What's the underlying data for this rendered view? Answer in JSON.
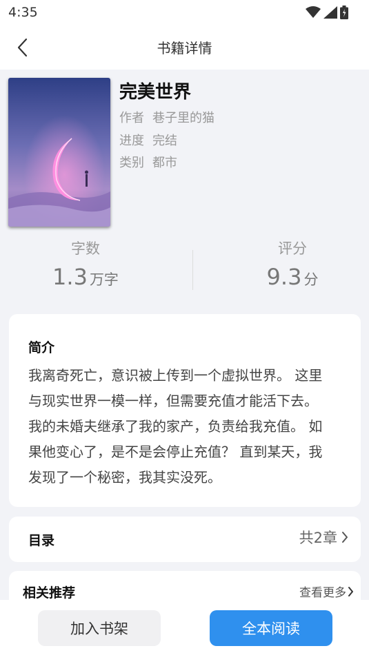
{
  "status_bar": {
    "time": "4:35",
    "icons": [
      "wifi-icon",
      "signal-icon",
      "battery-icon"
    ]
  },
  "nav": {
    "back_icon": "chevron-left-icon",
    "title": "书籍详情"
  },
  "book": {
    "title": "完美世界",
    "author_label": "作者",
    "author": "巷子里的猫",
    "progress_label": "进度",
    "progress": "完结",
    "category_label": "类别",
    "category": "都市"
  },
  "stats": {
    "words_label": "字数",
    "words_value": "1.3",
    "words_unit": "万字",
    "rating_label": "评分",
    "rating_value": "9.3",
    "rating_unit": "分"
  },
  "intro": {
    "heading": "简介",
    "lines": [
      "我离奇死亡，意识被上传到一个虚拟世界。 这里",
      "与现实世界一模一样，但需要充值才能活下去。",
      "我的未婚夫继承了我的家产，负责给我充值。 如",
      "果他变心了，是不是会停止充值？ 直到某天，我",
      "发现了一个秘密，我其实没死。"
    ]
  },
  "toc": {
    "label": "目录",
    "count": "共2章",
    "arrow_icon": "chevron-right-icon"
  },
  "recommend": {
    "label": "相关推荐",
    "more": "查看更多",
    "arrow_icon": "chevron-right-icon"
  },
  "actions": {
    "add_shelf": "加入书架",
    "read_all": "全本阅读"
  },
  "colors": {
    "accent": "#2f90ee",
    "background": "#f2f3f7"
  }
}
